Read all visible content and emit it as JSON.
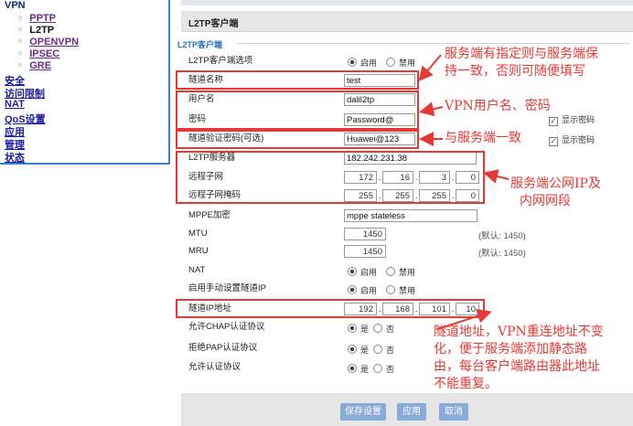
{
  "nav": {
    "vpn_label": "VPN",
    "vpn_items": [
      "PPTP",
      "L2TP",
      "OPENVPN",
      "IPSEC",
      "GRE"
    ],
    "groups": [
      "安全",
      "访问限制",
      "NAT",
      "QoS设置",
      "应用",
      "管理",
      "状态"
    ]
  },
  "header": {
    "title": "L2TP客户端"
  },
  "section": {
    "title": "L2TP客户端"
  },
  "form": {
    "client_option_label": "L2TP客户端选项",
    "enable": "启用",
    "disable": "禁用",
    "tunnel_name_label": "隧道名称",
    "tunnel_name_value": "test",
    "username_label": "用户名",
    "username_value": "dalil2tp",
    "password_label": "密码",
    "password_value": "Password@",
    "show_password": "显示密码",
    "tunnel_auth_label": "隧道验证密码(可选)",
    "tunnel_auth_value": "Huawei@123",
    "server_label": "L2TP服务器",
    "server_value": "182.242.231.38",
    "remote_subnet_label": "远程子网",
    "remote_subnet": [
      "172",
      "16",
      "3",
      "0"
    ],
    "remote_mask_label": "远程子网掩码",
    "remote_mask": [
      "255",
      "255",
      "255",
      "0"
    ],
    "mppe_label": "MPPE加密",
    "mppe_value": "mppe stateless",
    "mtu_label": "MTU",
    "mtu_value": "1450",
    "mtu_default": "(默认: 1450)",
    "mru_label": "MRU",
    "mru_value": "1450",
    "mru_default": "(默认: 1450)",
    "nat_label": "NAT",
    "manual_ip_label": "启用手动设置隧道IP",
    "tunnel_ip_label": "隧道IP地址",
    "tunnel_ip": [
      "192",
      "168",
      "101",
      "10"
    ],
    "chap_label": "允许CHAP认证协议",
    "pap_label": "拒绝PAP认证协议",
    "auth_label": "允许认证协议",
    "yes": "是",
    "no": "否"
  },
  "notes": {
    "server_match": [
      "服务端有指定则与服务端保",
      "持一致，否则可随便填写"
    ],
    "vpn_user": "VPN用户名、密码",
    "match_server": "与服务端一致",
    "public_ip": [
      "服务端公网IP及",
      "内网网段"
    ],
    "tunnel_addr": [
      "隧道地址，VPN重连地址不变",
      "化，便于服务端添加静态路",
      "由，每台客户端路由器此地址",
      "不能重复。"
    ]
  },
  "buttons": {
    "save": "保存设置",
    "apply": "应用",
    "cancel": "取消"
  },
  "colors": {
    "annotation": "#e53935",
    "nav_border": "#3b82c8",
    "button": "#8aaad8",
    "section": "#2a6fc0"
  }
}
